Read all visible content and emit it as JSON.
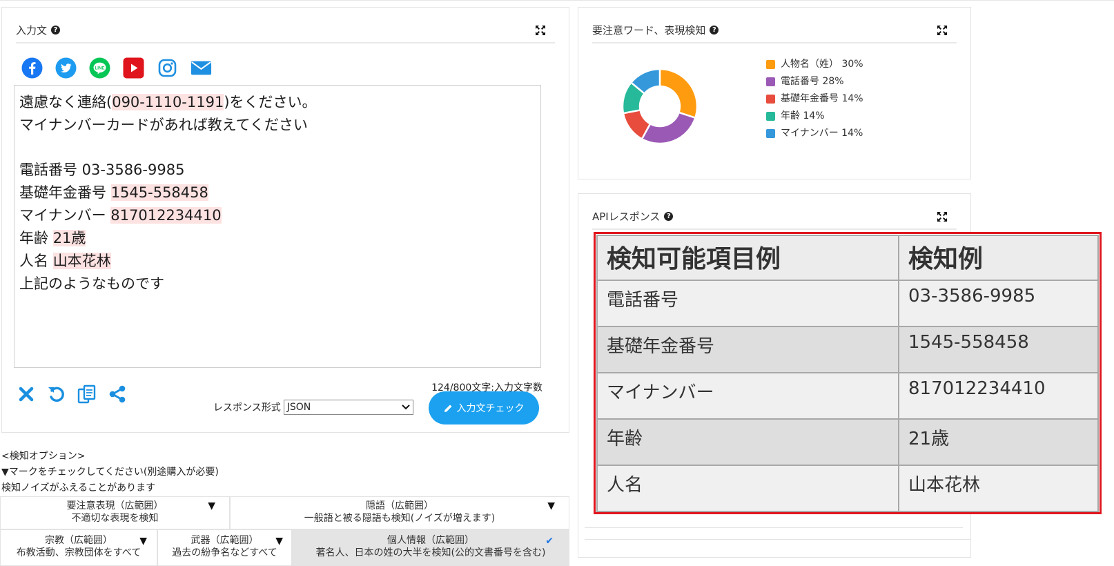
{
  "input_panel": {
    "title": "入力文",
    "social_icons": [
      "facebook-icon",
      "twitter-icon",
      "line-icon",
      "youtube-icon",
      "instagram-icon",
      "mail-icon"
    ],
    "text_lines": [
      {
        "parts": [
          {
            "t": "遠慮なく連絡("
          },
          {
            "t": "090-1110-1191",
            "hl": true
          },
          {
            "t": ")をください。"
          }
        ]
      },
      {
        "parts": [
          {
            "t": "マイナンバーカードがあれば教えてください"
          }
        ]
      },
      {
        "parts": [
          {
            "t": ""
          }
        ]
      },
      {
        "parts": [
          {
            "t": "電話番号 03-3586-9985"
          }
        ]
      },
      {
        "parts": [
          {
            "t": "基礎年金番号 "
          },
          {
            "t": "1545-558458",
            "hl": true
          }
        ]
      },
      {
        "parts": [
          {
            "t": "マイナンバー "
          },
          {
            "t": "817012234410",
            "hl": true
          }
        ]
      },
      {
        "parts": [
          {
            "t": "年齢 "
          },
          {
            "t": "21歳",
            "hl": true
          }
        ]
      },
      {
        "parts": [
          {
            "t": "人名 "
          },
          {
            "t": "山本花林",
            "hl": true
          }
        ]
      },
      {
        "parts": [
          {
            "t": "上記のようなものです"
          }
        ]
      }
    ],
    "char_count": "124/800文字:入力文字数",
    "response_format_label": "レスポンス形式",
    "response_format_value": "JSON",
    "check_button": "入力文チェック"
  },
  "options": {
    "heading": "<検知オプション>",
    "note1": "▼マークをチェックしてください(別途購入が必要)",
    "note2": "検知ノイズがふえることがあります",
    "items": [
      {
        "title": "要注意表現（広範囲）",
        "desc": "不適切な表現を検知",
        "state": "▼"
      },
      {
        "title": "隠語（広範囲）",
        "desc": "一般語と被る隠語も検知(ノイズが増えます)",
        "state": "▼"
      },
      {
        "title": "宗教（広範囲）",
        "desc": "布教活動、宗教団体をすべて",
        "state": "▼"
      },
      {
        "title": "武器（広範囲）",
        "desc": "過去の紛争名などすべて",
        "state": "▼"
      },
      {
        "title": "個人情報（広範囲）",
        "desc": "著名人、日本の姓の大半を検知(公的文書番号を含む)",
        "state": "✔"
      }
    ]
  },
  "words_panel": {
    "title": "要注意ワード、表現検知"
  },
  "chart_data": {
    "type": "pie",
    "donut": true,
    "categories": [
      "人物名（姓）",
      "電話番号",
      "基礎年金番号",
      "年齢",
      "マイナンバー"
    ],
    "values": [
      30,
      28,
      14,
      14,
      14
    ],
    "legend_labels": [
      "人物名（姓） 30%",
      "電話番号 28%",
      "基礎年金番号 14%",
      "年齢 14%",
      "マイナンバー 14%"
    ],
    "colors": [
      "#ff9b0e",
      "#9b59b6",
      "#e74c3c",
      "#26b99a",
      "#3498db"
    ],
    "legend": "right"
  },
  "api_panel": {
    "title": "APIレスポンス",
    "table": {
      "headers": [
        "検知可能項目例",
        "検知例"
      ],
      "rows": [
        [
          "電話番号",
          "03-3586-9985"
        ],
        [
          "基礎年金番号",
          "1545-558458"
        ],
        [
          "マイナンバー",
          "817012234410"
        ],
        [
          "年齢",
          "21歳"
        ],
        [
          "人名",
          "山本花林"
        ]
      ]
    }
  }
}
